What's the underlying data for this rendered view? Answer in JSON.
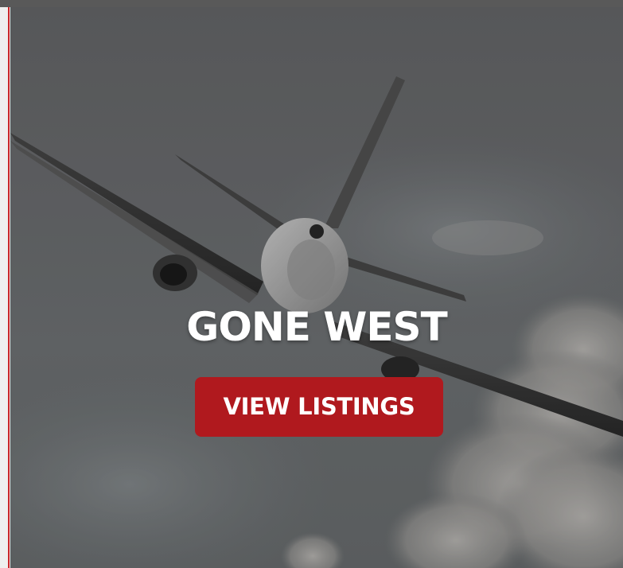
{
  "hero": {
    "title": "GONE WEST",
    "button_label": "VIEW LISTINGS"
  },
  "colors": {
    "accent": "#b0191e",
    "left_edge_line": "#c9262a",
    "top_bar": "#595959"
  }
}
